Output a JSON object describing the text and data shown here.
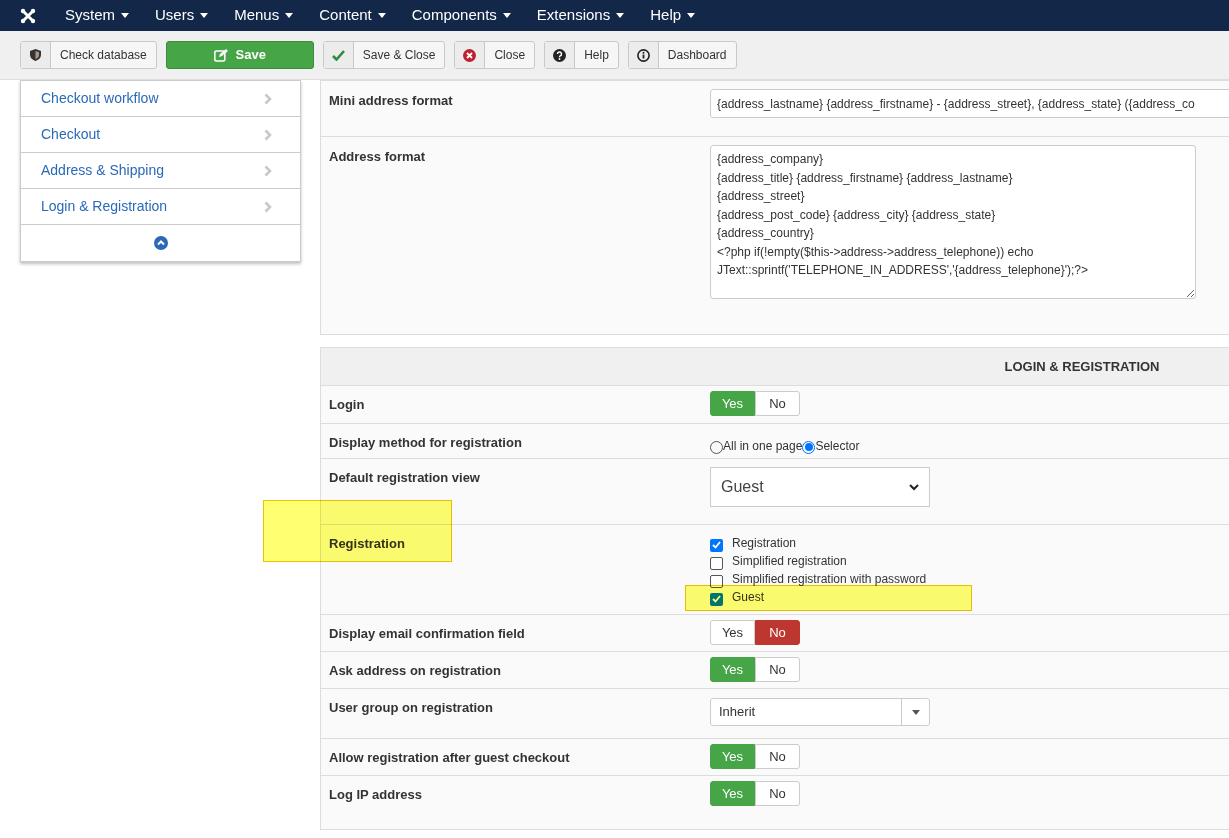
{
  "navbar": {
    "menus": [
      "System",
      "Users",
      "Menus",
      "Content",
      "Components",
      "Extensions",
      "Help"
    ]
  },
  "toolbar": {
    "buttons": [
      {
        "label": "Check database",
        "kind": "default"
      },
      {
        "label": "Save",
        "kind": "primary"
      },
      {
        "label": "Save & Close",
        "kind": "default"
      },
      {
        "label": "Close",
        "kind": "default"
      },
      {
        "label": "Help",
        "kind": "default"
      },
      {
        "label": "Dashboard",
        "kind": "default"
      }
    ]
  },
  "sidebar": {
    "items": [
      "Checkout workflow",
      "Checkout",
      "Address & Shipping",
      "Login & Registration"
    ]
  },
  "address_settings": [
    {
      "label": "Mini address format",
      "kind": "input",
      "value": "{address_lastname} {address_firstname} - {address_street}, {address_state} ({address_co"
    },
    {
      "label": "Address format",
      "kind": "textarea",
      "value": "{address_company}\n{address_title} {address_firstname} {address_lastname}\n{address_street}\n{address_post_code} {address_city} {address_state}\n{address_country}\n<?php if(!empty($this->address->address_telephone)) echo\nJText::sprintf('TELEPHONE_IN_ADDRESS','{address_telephone}');?>"
    }
  ],
  "section_title": "LOGIN & REGISTRATION",
  "settings": [
    {
      "label": "Login",
      "kind": "toggle",
      "highlighted": false,
      "options": [
        {
          "label": "Yes",
          "selected": true
        },
        {
          "label": "No",
          "selected": false
        }
      ]
    },
    {
      "label": "Display method for registration",
      "kind": "radio",
      "highlighted": false,
      "options": [
        {
          "label": "All in one page",
          "selected": false
        },
        {
          "label": "Selector",
          "selected": true
        }
      ]
    },
    {
      "label": "Default registration view",
      "kind": "select",
      "highlighted": false,
      "value": "Guest"
    },
    {
      "label": "Registration",
      "kind": "checkboxes",
      "highlighted": true,
      "options": [
        {
          "label": "Registration",
          "checked": true,
          "highlighted": false
        },
        {
          "label": "Simplified registration",
          "checked": false,
          "highlighted": false
        },
        {
          "label": "Simplified registration with password",
          "checked": false,
          "highlighted": false
        },
        {
          "label": "Guest",
          "checked": true,
          "highlighted": true
        }
      ]
    },
    {
      "label": "Display email confirmation field",
      "kind": "toggle",
      "highlighted": false,
      "options": [
        {
          "label": "Yes",
          "selected": false
        },
        {
          "label": "No",
          "selected": true
        }
      ]
    },
    {
      "label": "Ask address on registration",
      "kind": "toggle",
      "highlighted": false,
      "options": [
        {
          "label": "Yes",
          "selected": true
        },
        {
          "label": "No",
          "selected": false
        }
      ]
    },
    {
      "label": "User group on registration",
      "kind": "dropdown",
      "highlighted": false,
      "value": "Inherit"
    },
    {
      "label": "Allow registration after guest checkout",
      "kind": "toggle",
      "highlighted": false,
      "options": [
        {
          "label": "Yes",
          "selected": true
        },
        {
          "label": "No",
          "selected": false
        }
      ]
    },
    {
      "label": "Log IP address",
      "kind": "toggle",
      "highlighted": false,
      "options": [
        {
          "label": "Yes",
          "selected": true
        },
        {
          "label": "No",
          "selected": false
        }
      ]
    }
  ]
}
